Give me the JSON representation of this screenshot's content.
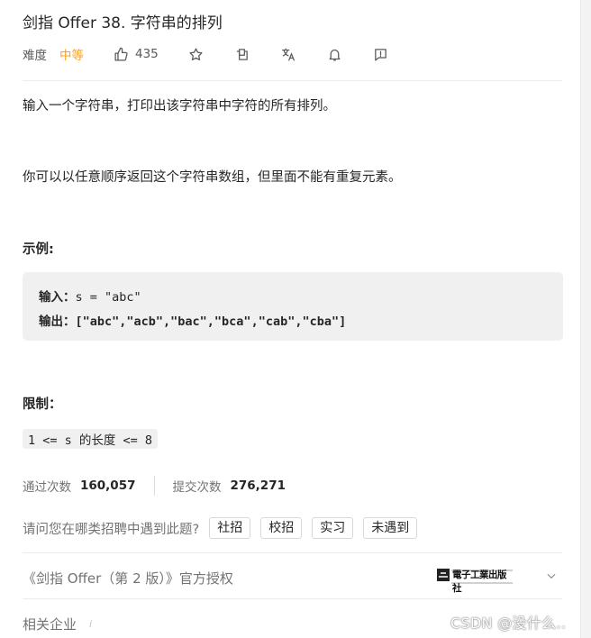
{
  "problem": {
    "title": "剑指 Offer 38. 字符串的排列",
    "difficulty_label": "难度",
    "difficulty_value": "中等",
    "like_count": "435",
    "description": [
      "输入一个字符串，打印出该字符串中字符的所有排列。",
      "你可以以任意顺序返回这个字符串数组，但里面不能有重复元素。"
    ],
    "example_heading": "示例:",
    "example_input_label": "输入：",
    "example_input_value": "s = \"abc\"",
    "example_output_label": "输出：",
    "example_output_value": "[\"abc\",\"acb\",\"bac\",\"bca\",\"cab\",\"cba\"]",
    "constraints_heading": "限制：",
    "constraint": "1 <= s 的长度 <= 8"
  },
  "stats": {
    "accepted_label": "通过次数",
    "accepted_value": "160,057",
    "submitted_label": "提交次数",
    "submitted_value": "276,271"
  },
  "survey": {
    "question": "请问您在哪类招聘中遇到此题?",
    "options": [
      "社招",
      "校招",
      "实习",
      "未遇到"
    ]
  },
  "license": {
    "text": "《剑指 Offer（第 2 版）》官方授权",
    "publisher_logo": "電子工業出版社"
  },
  "related": {
    "label": "相关企业",
    "info_icon": "i"
  },
  "watermark": "CSDN @没什么..",
  "icons": [
    "thumbs-up-icon",
    "star-icon",
    "share-icon",
    "translate-icon",
    "bell-icon",
    "feedback-icon",
    "chevron-down-icon",
    "info-icon"
  ],
  "colors": {
    "difficulty_medium": "#ffa116",
    "text": "#262626",
    "muted": "#737373"
  }
}
